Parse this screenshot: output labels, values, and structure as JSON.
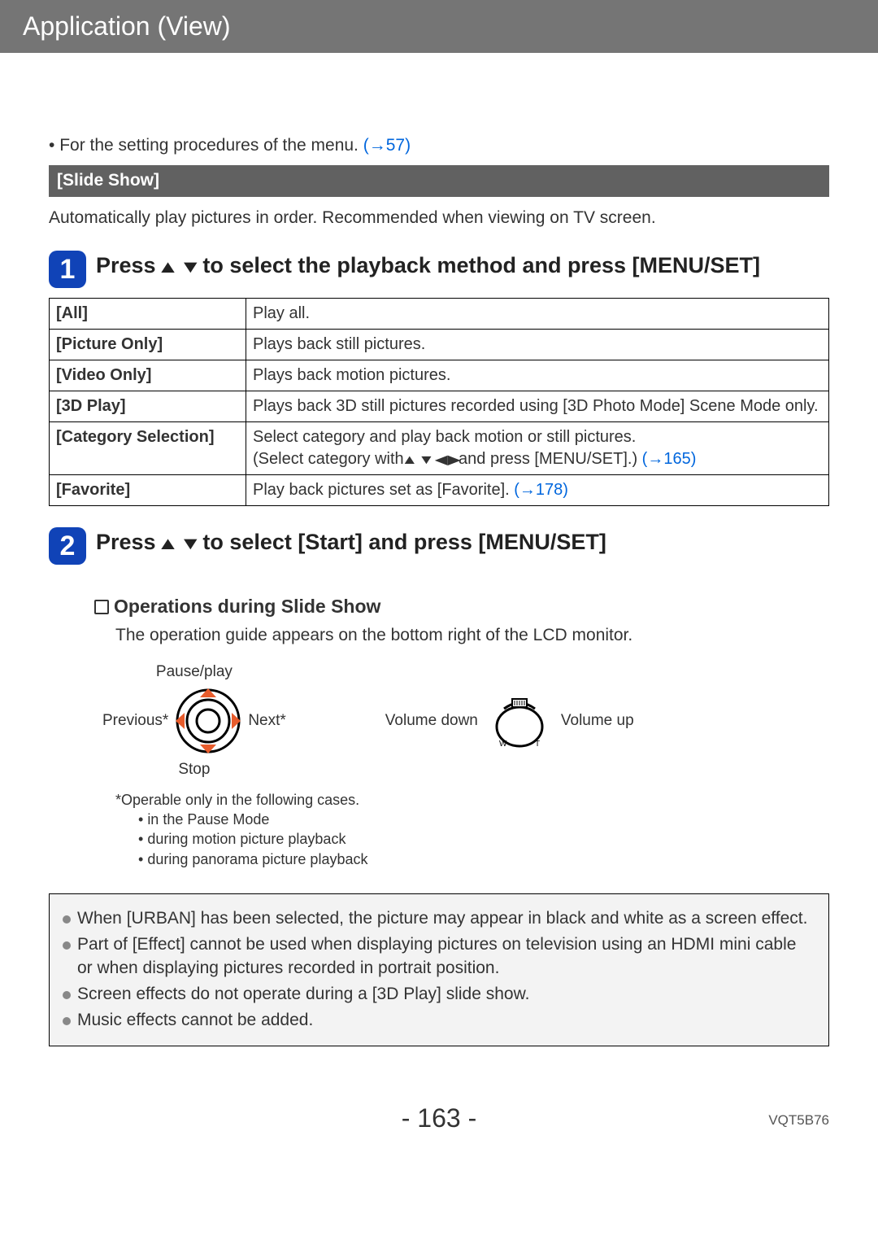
{
  "header": "Application (View)",
  "intro_text": "For the setting procedures of the menu.",
  "intro_link": "(→57)",
  "sectionbar": "[Slide Show]",
  "section_desc": "Automatically play pictures in order. Recommended when viewing on TV screen.",
  "step1": {
    "num": "1",
    "text_a": "Press ",
    "text_b": " to select the playback method and press [MENU/SET]"
  },
  "table": {
    "rows": [
      {
        "k": "[All]",
        "v": "Play all."
      },
      {
        "k": "[Picture Only]",
        "v": "Plays back still pictures."
      },
      {
        "k": "[Video Only]",
        "v": "Plays back motion pictures."
      },
      {
        "k": "[3D Play]",
        "v": "Plays back 3D still pictures recorded using [3D Photo Mode] Scene Mode only."
      },
      {
        "k": "[Category Selection]",
        "v": "Select category and play back motion or still pictures.",
        "v2a": "(Select category with ",
        "v2b": " and press [MENU/SET].)",
        "v2link": "(→165)"
      },
      {
        "k": "[Favorite]",
        "v": "Play back pictures set as [Favorite].",
        "vlink": "(→178)"
      }
    ]
  },
  "step2": {
    "num": "2",
    "text_a": "Press ",
    "text_b": " to select [Start] and press [MENU/SET]"
  },
  "operations_head": "Operations during Slide Show",
  "operations_desc": "The operation guide appears on the bottom right of the LCD monitor.",
  "dpad": {
    "up": "Pause/play",
    "left": "Previous*",
    "right": "Next*",
    "down": "Stop"
  },
  "volume": {
    "down": "Volume down",
    "up": "Volume up"
  },
  "star_note": "*Operable only in the following cases.",
  "star_bullets": [
    "in the Pause Mode",
    "during motion picture playback",
    "during panorama picture playback"
  ],
  "infobox": [
    "When [URBAN] has been selected, the picture may appear in black and white as a screen effect.",
    "Part of [Effect] cannot be used when displaying pictures on television using an HDMI mini cable or when displaying pictures recorded in portrait position.",
    "Screen effects do not operate during a [3D Play] slide show.",
    "Music effects cannot be added."
  ],
  "page_number": "- 163 -",
  "doc_id": "VQT5B76"
}
